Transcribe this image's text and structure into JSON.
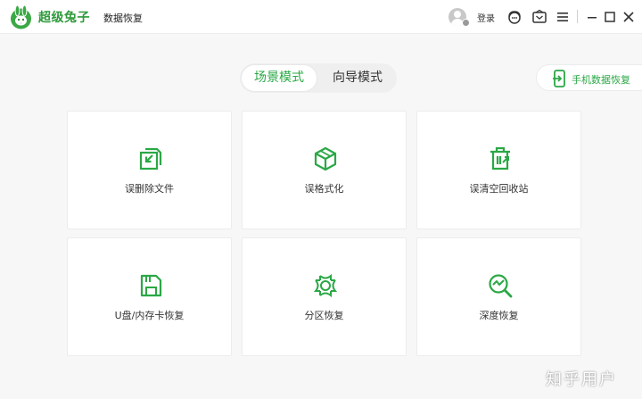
{
  "app": {
    "brand_name": "超级兔子",
    "brand_sub": "数据恢复",
    "accent_color": "#2aa845"
  },
  "titlebar": {
    "login_label": "登录",
    "icons": [
      "avatar-icon",
      "support-icon",
      "feedback-icon",
      "menu-icon",
      "minimize-icon",
      "maximize-icon",
      "close-icon"
    ]
  },
  "modes": {
    "active": "场景模式",
    "inactive": "向导模式"
  },
  "phone_recovery": {
    "label": "手机数据恢复",
    "icon": "phone-transfer-icon"
  },
  "cards": [
    {
      "label": "误删除文件",
      "icon": "file-restore-icon"
    },
    {
      "label": "误格式化",
      "icon": "box-icon"
    },
    {
      "label": "误清空回收站",
      "icon": "recycle-bin-icon"
    },
    {
      "label": "U盘/内存卡恢复",
      "icon": "sd-card-icon"
    },
    {
      "label": "分区恢复",
      "icon": "partition-icon"
    },
    {
      "label": "深度恢复",
      "icon": "deep-scan-icon"
    }
  ],
  "watermark": "知乎用户"
}
